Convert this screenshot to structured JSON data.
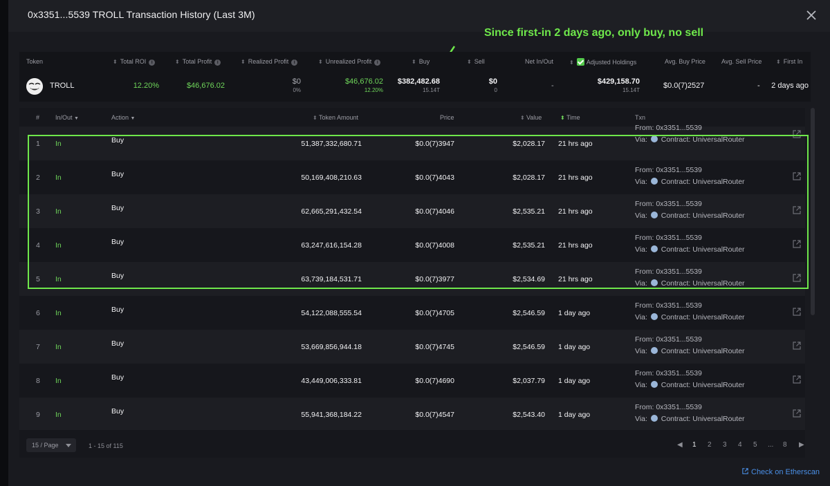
{
  "title": "0x3351...5539 TROLL Transaction History (Last 3M)",
  "annotation": "Since first-in 2 days ago, only buy, no sell",
  "colors": {
    "accent_green": "#6fe84b",
    "profit_green": "#6fd65a",
    "link_blue": "#4a8fe6"
  },
  "summary": {
    "headers": {
      "token": "Token",
      "total_roi": "Total ROI",
      "total_profit": "Total Profit",
      "realized_profit": "Realized Profit",
      "unrealized_profit": "Unrealized Profit",
      "buy": "Buy",
      "sell": "Sell",
      "net_in_out": "Net In/Out",
      "adjusted_holdings": "Adjusted Holdings",
      "avg_buy_price": "Avg. Buy Price",
      "avg_sell_price": "Avg. Sell Price",
      "first_in": "First In"
    },
    "token": "TROLL",
    "total_roi": "12.20%",
    "total_profit": "$46,676.02",
    "realized_profit": "$0",
    "realized_profit_pct": "0%",
    "unrealized_profit": "$46,676.02",
    "unrealized_profit_pct": "12.20%",
    "buy": "$382,482.68",
    "buy_amount": "15.14T",
    "sell": "$0",
    "sell_amount": "0",
    "net_in_out": "-",
    "adjusted_holdings": "$429,158.70",
    "adjusted_holdings_amount": "15.14T",
    "avg_buy_price": "$0.0(7)2527",
    "avg_sell_price": "-",
    "first_in": "2 days ago"
  },
  "table": {
    "headers": {
      "num": "#",
      "in_out": "In/Out",
      "action": "Action",
      "token_amount": "Token Amount",
      "price": "Price",
      "value": "Value",
      "time": "Time",
      "txn": "Txn"
    },
    "rows": [
      {
        "n": "1",
        "dir": "In",
        "action": "Buy",
        "amount": "51,387,332,680.71",
        "price": "$0.0(7)3947",
        "value": "$2,028.17",
        "time": "21 hrs ago",
        "from": "From: 0x3351...5539",
        "via_label": "Via:",
        "via": "Contract: UniversalRouter"
      },
      {
        "n": "2",
        "dir": "In",
        "action": "Buy",
        "amount": "50,169,408,210.63",
        "price": "$0.0(7)4043",
        "value": "$2,028.17",
        "time": "21 hrs ago",
        "from": "From: 0x3351...5539",
        "via_label": "Via:",
        "via": "Contract: UniversalRouter"
      },
      {
        "n": "3",
        "dir": "In",
        "action": "Buy",
        "amount": "62,665,291,432.54",
        "price": "$0.0(7)4046",
        "value": "$2,535.21",
        "time": "21 hrs ago",
        "from": "From: 0x3351...5539",
        "via_label": "Via:",
        "via": "Contract: UniversalRouter"
      },
      {
        "n": "4",
        "dir": "In",
        "action": "Buy",
        "amount": "63,247,616,154.28",
        "price": "$0.0(7)4008",
        "value": "$2,535.21",
        "time": "21 hrs ago",
        "from": "From: 0x3351...5539",
        "via_label": "Via:",
        "via": "Contract: UniversalRouter"
      },
      {
        "n": "5",
        "dir": "In",
        "action": "Buy",
        "amount": "63,739,184,531.71",
        "price": "$0.0(7)3977",
        "value": "$2,534.69",
        "time": "21 hrs ago",
        "from": "From: 0x3351...5539",
        "via_label": "Via:",
        "via": "Contract: UniversalRouter"
      },
      {
        "n": "6",
        "dir": "In",
        "action": "Buy",
        "amount": "54,122,088,555.54",
        "price": "$0.0(7)4705",
        "value": "$2,546.59",
        "time": "1 day ago",
        "from": "From: 0x3351...5539",
        "via_label": "Via:",
        "via": "Contract: UniversalRouter"
      },
      {
        "n": "7",
        "dir": "In",
        "action": "Buy",
        "amount": "53,669,856,944.18",
        "price": "$0.0(7)4745",
        "value": "$2,546.59",
        "time": "1 day ago",
        "from": "From: 0x3351...5539",
        "via_label": "Via:",
        "via": "Contract: UniversalRouter"
      },
      {
        "n": "8",
        "dir": "In",
        "action": "Buy",
        "amount": "43,449,006,333.81",
        "price": "$0.0(7)4690",
        "value": "$2,037.79",
        "time": "1 day ago",
        "from": "From: 0x3351...5539",
        "via_label": "Via:",
        "via": "Contract: UniversalRouter"
      },
      {
        "n": "9",
        "dir": "In",
        "action": "Buy",
        "amount": "55,941,368,184.22",
        "price": "$0.0(7)4547",
        "value": "$2,543.40",
        "time": "1 day ago",
        "from": "From: 0x3351...5539",
        "via_label": "Via:",
        "via": "Contract: UniversalRouter"
      }
    ]
  },
  "footer": {
    "per_page": "15 / Page",
    "range": "1 - 15 of 115",
    "pages": [
      "1",
      "2",
      "3",
      "4",
      "5",
      "...",
      "8"
    ],
    "active_page": "1",
    "etherscan_link": "Check on Etherscan"
  }
}
